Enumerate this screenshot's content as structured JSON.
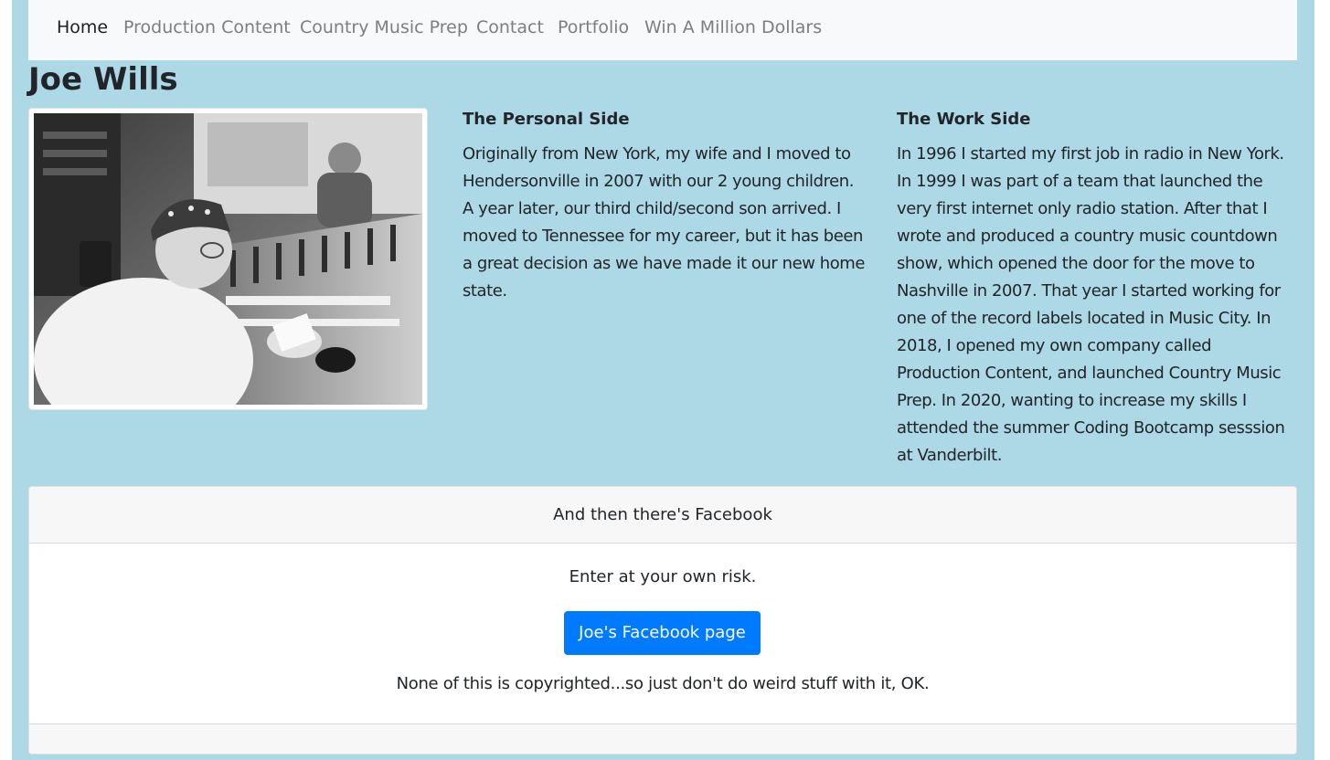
{
  "nav": {
    "items": [
      {
        "label": "Home"
      },
      {
        "label": "Production Content"
      },
      {
        "label": "Country Music Prep"
      },
      {
        "label": "Contact"
      },
      {
        "label": "Portfolio"
      },
      {
        "label": "Win A Million Dollars"
      }
    ]
  },
  "page_title": "Joe Wills",
  "photo": {
    "alt": "Black and white photo of Joe at a radio studio mixing console"
  },
  "personal": {
    "heading": "The Personal Side",
    "body": "Originally from New York, my wife and I moved to Hendersonville in 2007 with our 2 young children. A year later, our third child/second son arrived. I moved to Tennessee for my career, but it has been a great decision as we have made it our new home state."
  },
  "work": {
    "heading": "The Work Side",
    "body": "In 1996 I started my first job in radio in New York. In 1999 I was part of a team that launched the very first internet only radio station. After that I wrote and produced a country music countdown show, which opened the door for the move to Nashville in 2007. That year I started working for one of the record labels located in Music City. In 2018, I opened my own company called Production Content, and launched Country Music Prep. In 2020, wanting to increase my skills I attended the summer Coding Bootcamp sesssion at Vanderbilt."
  },
  "facebook_card": {
    "header": "And then there's Facebook",
    "text": "Enter at your own risk.",
    "button_label": "Joe's Facebook page",
    "note": "None of this is copyrighted...so just don't do weird stuff with it, OK."
  },
  "colors": {
    "page_background": "#add8e6",
    "navbar_background": "#f8f9fa",
    "button_primary": "#007bff"
  }
}
